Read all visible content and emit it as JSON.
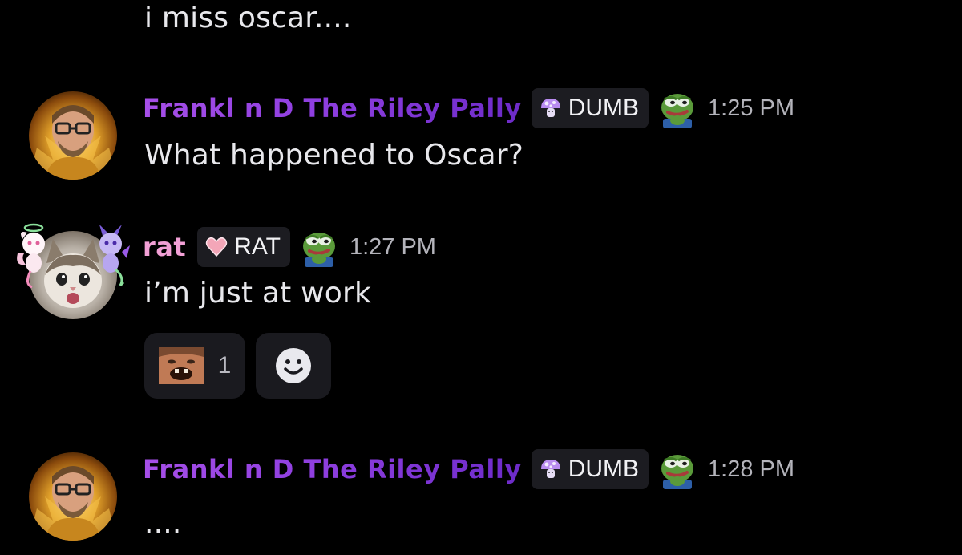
{
  "messages": [
    {
      "text": "i miss oscar...."
    },
    {
      "author": "Frankl  n D The Riley  Pally",
      "role": "DUMB",
      "role_icon": "purple-mushroom-icon",
      "emote": "pepe-frog-icon",
      "timestamp": "1:25 PM",
      "text": "What happened to Oscar?"
    },
    {
      "author": "rat",
      "role": "RAT",
      "role_icon": "pink-heart-icon",
      "emote": "pepe-frog-icon",
      "timestamp": "1:27 PM",
      "text": "i’m just at work",
      "reactions": [
        {
          "emoji": "laughing-man-emoji",
          "count": "1"
        }
      ],
      "add_reaction_icon": "smiley-face-icon"
    },
    {
      "author": "Frankl  n D The Riley  Pally",
      "role": "DUMB",
      "role_icon": "purple-mushroom-icon",
      "emote": "pepe-frog-icon",
      "timestamp": "1:28 PM",
      "text": "...."
    }
  ],
  "colors": {
    "background": "#000000",
    "franklin_name": "#8f3fe0",
    "rat_name": "#f2a0d6",
    "tag_background": "#1c1c21",
    "timestamp": "#b4b4bb",
    "reaction_background": "#1a1a1f"
  }
}
